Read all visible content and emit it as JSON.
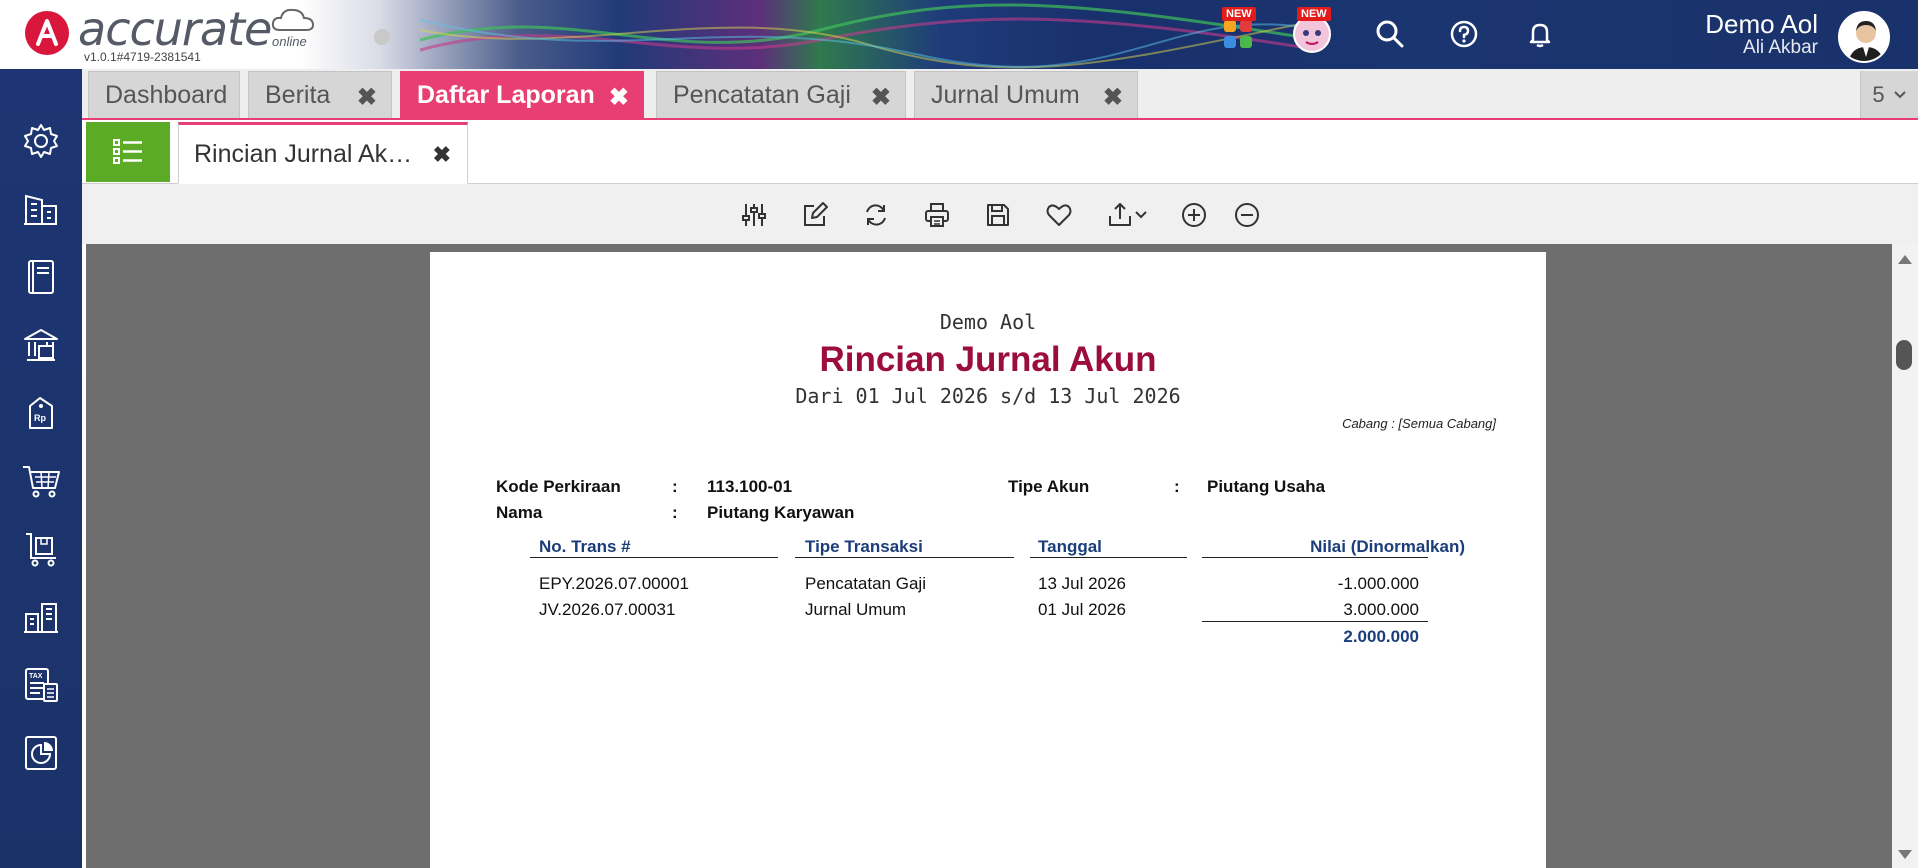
{
  "header": {
    "logo_text": "accurate",
    "logo_sub": "online",
    "version": "v1.0.1#4719-2381541",
    "badge_new_1": "NEW",
    "badge_new_2": "NEW",
    "user_name": "Demo Aol",
    "user_sub": "Ali Akbar",
    "brand_color": "#d9163b",
    "icons": [
      "apps-icon",
      "mascot-icon",
      "search-icon",
      "help-icon",
      "bell-icon"
    ]
  },
  "sidebar": {
    "items": [
      "settings-icon",
      "company-icon",
      "ledger-book-icon",
      "bank-icon",
      "price-tag-icon",
      "cart-icon",
      "purchase-icon",
      "warehouse-icon",
      "tax-icon",
      "report-chart-icon"
    ]
  },
  "tabs": {
    "items": [
      {
        "label": "Dashboard"
      },
      {
        "label": "Berita"
      },
      {
        "label": "Daftar Laporan"
      },
      {
        "label": "Pencatatan Gaji"
      },
      {
        "label": "Jurnal Umum"
      }
    ],
    "count": "5",
    "close_glyph": "✖",
    "active_color": "#e83e74"
  },
  "subtab": {
    "label": "Rincian Jurnal Ak…"
  },
  "toolbar": {
    "icons": [
      "filter-sliders-icon",
      "edit-icon",
      "refresh-icon",
      "print-icon",
      "save-icon",
      "favorite-icon",
      "export-icon",
      "zoom-in-icon",
      "zoom-out-icon"
    ]
  },
  "report": {
    "company": "Demo Aol",
    "title": "Rincian Jurnal Akun",
    "period": "Dari 01 Jul 2026 s/d 13 Jul 2026",
    "branch": "Cabang : [Semua Cabang]",
    "kode_label": "Kode Perkiraan",
    "kode_value": "113.100-01",
    "nama_label": "Nama",
    "nama_value": "Piutang Karyawan",
    "tipe_label": "Tipe Akun",
    "tipe_value": "Piutang Usaha",
    "colon": ":",
    "columns": [
      "No. Trans #",
      "Tipe Transaksi",
      "Tanggal",
      "Nilai (Dinormalkan)"
    ],
    "rows": [
      {
        "no": "EPY.2026.07.00001",
        "tipe": "Pencatatan Gaji",
        "tanggal": "13 Jul 2026",
        "nilai": "-1.000.000"
      },
      {
        "no": "JV.2026.07.00031",
        "tipe": "Jurnal Umum",
        "tanggal": "01 Jul 2026",
        "nilai": "3.000.000"
      }
    ],
    "total": "2.000.000",
    "title_color": "#9b0c3f",
    "header_color": "#1b3d7a"
  }
}
